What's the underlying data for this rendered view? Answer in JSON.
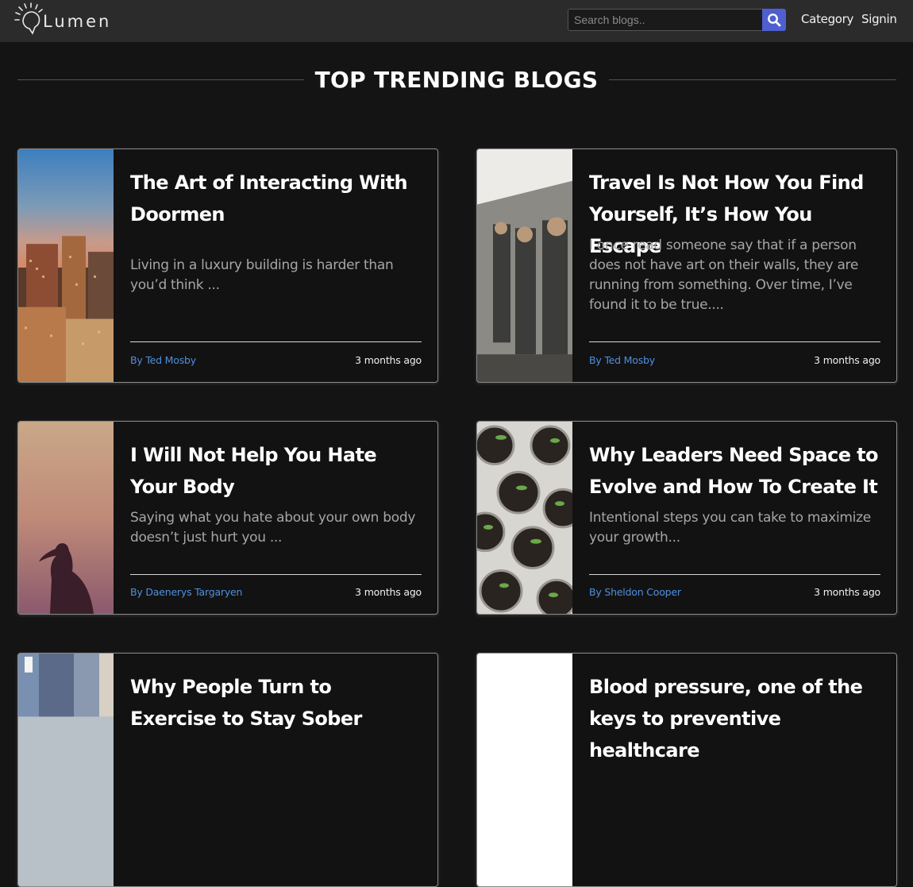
{
  "brand": {
    "name": "Lumen",
    "logo_icon": "lightbulb-speech-bubble-logo"
  },
  "search": {
    "placeholder": "Search blogs..",
    "value": "",
    "button_icon": "search-icon"
  },
  "nav": {
    "category_label": "Category",
    "signin_label": "Signin"
  },
  "page": {
    "title": "TOP TRENDING BLOGS"
  },
  "colors": {
    "background": "#141414",
    "navbar": "#2b2b2b",
    "search_button": "#4f5fd0",
    "author_link": "#4f8fe0"
  },
  "blogs": [
    {
      "title": "The Art of Interacting With Doormen",
      "description": "Living in a luxury building is harder than you’d think ...",
      "author": "By Ted Mosby",
      "time": "3 months ago",
      "image": "city-skyline-image"
    },
    {
      "title": "Travel Is Not How You Find Yourself, It’s How You Escape",
      "description": "I once read someone say that if a person does not have art on their walls, they are running from something. Over time, I’ve found it to be true....",
      "author": "By Ted Mosby",
      "time": "3 months ago",
      "image": "airplane-cabin-image"
    },
    {
      "title": "I Will Not Help You Hate Your Body",
      "description": "Saying what you hate about your own body doesn’t just hurt you ...",
      "author": "By Daenerys Targaryen",
      "time": "3 months ago",
      "image": "woman-silhouette-sunset-image"
    },
    {
      "title": "Why Leaders Need Space to Evolve and How To Create It",
      "description": "Intentional steps you can take to maximize your growth...",
      "author": "By Sheldon Cooper",
      "time": "3 months ago",
      "image": "seedling-pots-image"
    },
    {
      "title": "Why People Turn to Exercise to Stay Sober",
      "description": "",
      "author": "",
      "time": "",
      "image": "runners-image"
    },
    {
      "title": "Blood pressure, one of the keys to preventive healthcare",
      "description": "",
      "author": "",
      "time": "",
      "image": "blank-white-image"
    }
  ]
}
